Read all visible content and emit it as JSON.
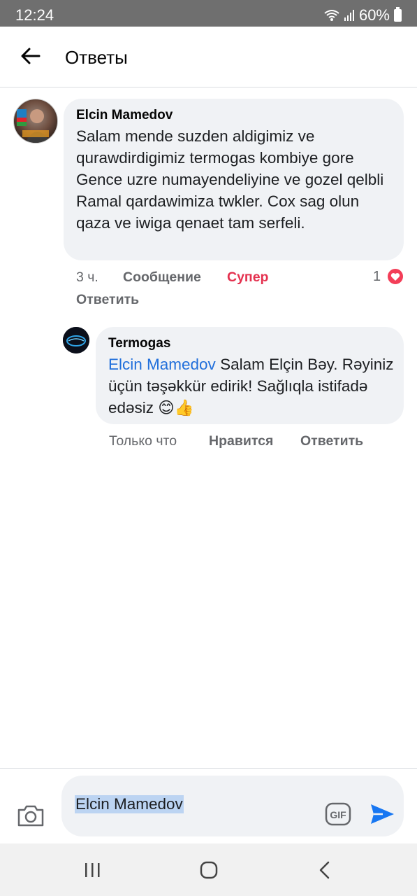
{
  "status": {
    "time": "12:24",
    "battery": "60%"
  },
  "header": {
    "title": "Ответы"
  },
  "comment": {
    "author": "Elcin Mamedov",
    "text": "Salam mende suzden aldigimiz ve qurawdirdigimiz termogas kombiye gore Gence uzre numayendeliyine ve gozel qelbli Ramal qardawimiza twkler. Cox sag olun qaza ve iwiga qenaet tam serfeli.",
    "time": "3 ч.",
    "message_label": "Сообщение",
    "reaction_label": "Супер",
    "reply_label": "Ответить",
    "reaction_count": "1"
  },
  "reply": {
    "author": "Termogas",
    "mention": "Elcin Mamedov",
    "text": " Salam Elçin Bəy. Rəyiniz üçün təşəkkür edirik! Sağlıqla istifadə edəsiz 😊👍",
    "time": "Только что",
    "like_label": "Нравится",
    "reply_label": "Ответить"
  },
  "composer": {
    "value": "Elcin Mamedov",
    "gif_label": "GIF"
  },
  "colors": {
    "accent": "#1877f2",
    "super": "#e4314f",
    "heart": "#f33e58",
    "mention": "#216fdb"
  }
}
